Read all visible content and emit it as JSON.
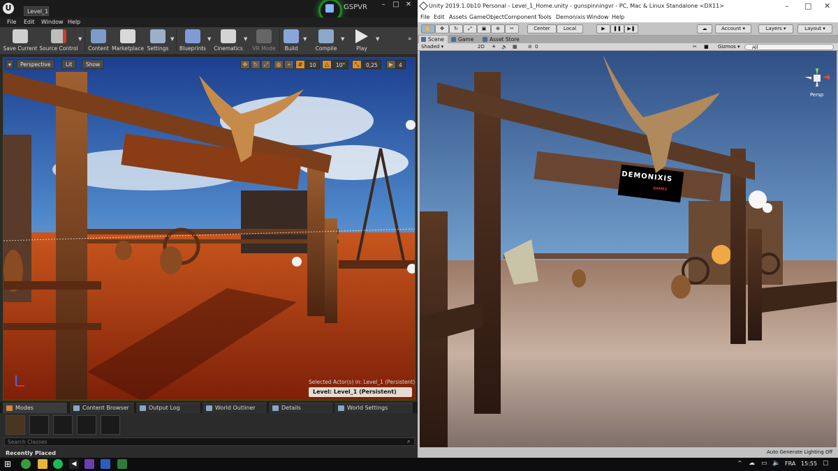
{
  "unreal": {
    "tab_title": "Level_1",
    "plugin_label": "GSPVR",
    "window_buttons": [
      "–",
      "□",
      "✕"
    ],
    "menu": [
      "File",
      "Edit",
      "Window",
      "Help"
    ],
    "toolbar": [
      {
        "label": "Save Current",
        "icon": "save-icon"
      },
      {
        "label": "Source Control",
        "icon": "source-control-icon"
      },
      {
        "label": "Content",
        "icon": "content-icon"
      },
      {
        "label": "Marketplace",
        "icon": "marketplace-icon"
      },
      {
        "label": "Settings",
        "icon": "settings-icon"
      },
      {
        "label": "Blueprints",
        "icon": "blueprints-icon"
      },
      {
        "label": "Cinematics",
        "icon": "cinematics-icon"
      },
      {
        "label": "VR Mode",
        "icon": "vr-mode-icon"
      },
      {
        "label": "Build",
        "icon": "build-icon"
      },
      {
        "label": "Compile",
        "icon": "compile-icon"
      },
      {
        "label": "Play",
        "icon": "play-icon"
      }
    ],
    "viewport": {
      "perspective": "Perspective",
      "lit": "Lit",
      "show": "Show",
      "grid_snap": "10",
      "rotation_snap": "10°",
      "scale_snap": "0,25",
      "camera_speed": "4",
      "selected_actors": "Selected Actor(s) in:  Level_1 (Persistent)",
      "level": "Level:  Level_1 (Persistent)"
    },
    "panel_tabs": [
      "Modes",
      "Content Browser",
      "Output Log",
      "World Outliner",
      "Details",
      "World Settings"
    ],
    "search_placeholder": "Search Classes",
    "recently_placed": "Recently Placed"
  },
  "unity": {
    "title": "Unity 2019.1.0b10 Personal - Level_1_Home.unity - gunspinningvr - PC, Mac & Linux Standalone <DX11>",
    "window_buttons": [
      "–",
      "□",
      "✕"
    ],
    "menu": [
      "File",
      "Edit",
      "Assets",
      "GameObject",
      "Component",
      "Tools",
      "Demonixis",
      "Window",
      "Help"
    ],
    "toolbar": {
      "center": "Center",
      "local": "Local",
      "account": "Account",
      "layers": "Layers",
      "layout": "Layout"
    },
    "tabs": [
      "Scene",
      "Game",
      "Asset Store"
    ],
    "scenebar": {
      "shaded": "Shaded",
      "mode_2d": "2D",
      "fx_count": "0",
      "gizmos": "Gizmos",
      "search": "All"
    },
    "sign_text": "DEMONIXIS",
    "sign_sub": "GAMES",
    "persp": "Persp",
    "status": "Auto Generate Lighting Off"
  },
  "taskbar": {
    "lang": "FRA",
    "time": "15:55"
  },
  "colors": {
    "ue_accent": "#1f8a27",
    "unity_bg": "#c2c2c2",
    "desert": "#b5401a"
  }
}
